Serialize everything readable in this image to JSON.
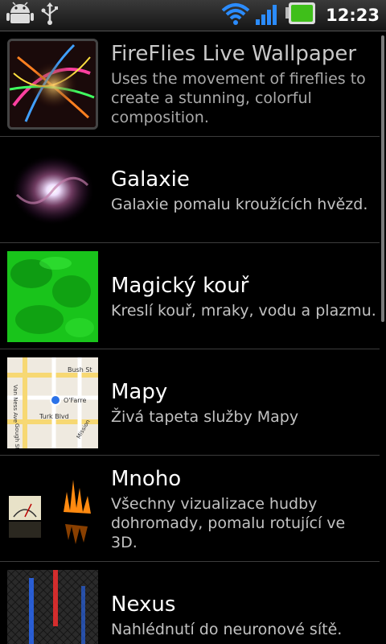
{
  "status_bar": {
    "time": "12:23",
    "left_icons": [
      "android-icon",
      "usb-icon"
    ],
    "right_icons": [
      "wifi-icon",
      "signal-icon",
      "battery-icon"
    ],
    "battery_color": "#3fbf1a",
    "signal_color": "#2b8cff"
  },
  "wallpapers": [
    {
      "title": "FireFlies Live Wallpaper",
      "desc": "Uses the movement of fireflies to create a stunning, colorful composition.",
      "icon": "fireflies-thumbnail"
    },
    {
      "title": "Galaxie",
      "desc": "Galaxie pomalu kroužících hvězd.",
      "icon": "galaxy-thumbnail"
    },
    {
      "title": "Magický kouř",
      "desc": "Kreslí kouř, mraky, vodu a plazmu.",
      "icon": "smoke-thumbnail"
    },
    {
      "title": "Mapy",
      "desc": "Živá tapeta služby Mapy",
      "icon": "map-thumbnail"
    },
    {
      "title": "Mnoho",
      "desc": "Všechny vizualizace hudby dohromady, pomalu rotující ve 3D.",
      "icon": "music-visualizer-thumbnail"
    },
    {
      "title": "Nexus",
      "desc": "Nahlédnutí do neuronové sítě.",
      "icon": "nexus-thumbnail"
    }
  ],
  "map_labels": {
    "a": "Van Ness Ave",
    "b": "Bush St",
    "c": "O'Farre",
    "d": "Turk Blvd",
    "e": "Gough St",
    "f": "Mission"
  }
}
